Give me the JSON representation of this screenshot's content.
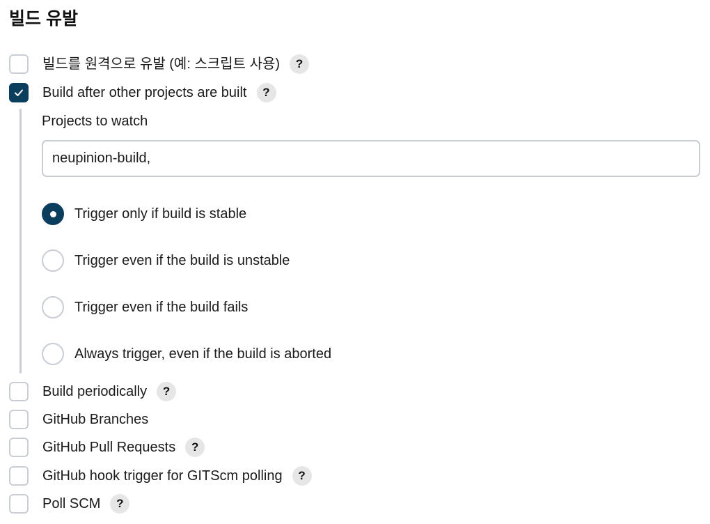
{
  "section": {
    "title": "빌드 유발"
  },
  "help_symbol": "?",
  "triggers": {
    "remote": {
      "label": "빌드를 원격으로 유발 (예: 스크립트 사용)",
      "checked": false
    },
    "after_other": {
      "label": "Build after other projects are built",
      "checked": true
    },
    "periodically": {
      "label": "Build periodically",
      "checked": false
    },
    "github_branches": {
      "label": "GitHub Branches",
      "checked": false
    },
    "github_pr": {
      "label": "GitHub Pull Requests",
      "checked": false
    },
    "github_hook": {
      "label": "GitHub hook trigger for GITScm polling",
      "checked": false
    },
    "poll_scm": {
      "label": "Poll SCM",
      "checked": false
    }
  },
  "projects_to_watch": {
    "label": "Projects to watch",
    "value": "neupinion-build,"
  },
  "trigger_options": [
    {
      "label": "Trigger only if build is stable",
      "selected": true
    },
    {
      "label": "Trigger even if the build is unstable",
      "selected": false
    },
    {
      "label": "Trigger even if the build fails",
      "selected": false
    },
    {
      "label": "Always trigger, even if the build is aborted",
      "selected": false
    }
  ],
  "colors": {
    "accent": "#0b3d5c",
    "border": "#c9ced5",
    "help_bg": "#e6e6e6"
  }
}
